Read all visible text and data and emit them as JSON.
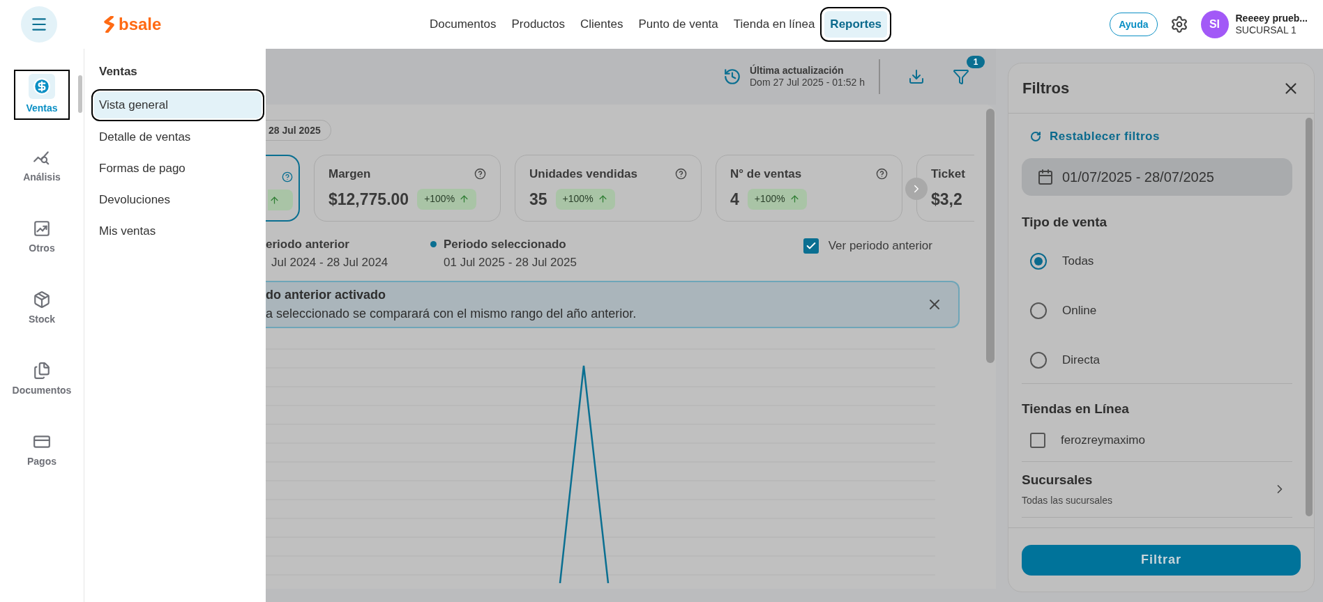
{
  "top_bar": {
    "brand": "bsale",
    "nav": [
      {
        "label": "Documentos",
        "selected": false
      },
      {
        "label": "Productos",
        "selected": false
      },
      {
        "label": "Clientes",
        "selected": false
      },
      {
        "label": "Punto de venta",
        "selected": false
      },
      {
        "label": "Tienda en línea",
        "selected": false
      },
      {
        "label": "Reportes",
        "selected": true
      }
    ],
    "help_button": "Ayuda",
    "user": {
      "initials": "SI",
      "name": "Reeeey prueb...",
      "branch": "SUCURSAL 1"
    }
  },
  "sidebar": {
    "items": [
      {
        "label": "Ventas",
        "selected": true
      },
      {
        "label": "Análisis",
        "selected": false
      },
      {
        "label": "Otros",
        "selected": false
      },
      {
        "label": "Stock",
        "selected": false
      },
      {
        "label": "Documentos",
        "selected": false
      },
      {
        "label": "Pagos",
        "selected": false
      }
    ]
  },
  "menu": {
    "title": "Ventas",
    "items": [
      {
        "label": "Vista general",
        "selected": true
      },
      {
        "label": "Detalle de ventas",
        "selected": false
      },
      {
        "label": "Formas de pago",
        "selected": false
      },
      {
        "label": "Devoluciones",
        "selected": false
      },
      {
        "label": "Mis ventas",
        "selected": false
      }
    ]
  },
  "report": {
    "last_update": {
      "label": "Última actualización",
      "value": "Dom 27 Jul 2025 - 01:52 h"
    },
    "filter_count": "1",
    "date_chip": "28 Jul 2025",
    "kpis": [
      {
        "kind": "partial",
        "selected": true
      },
      {
        "kind": "full",
        "title": "Margen",
        "value": "$12,775.00",
        "badge": "+100%",
        "selected": false
      },
      {
        "kind": "full",
        "title": "Unidades vendidas",
        "value": "35",
        "badge": "+100%",
        "selected": false
      },
      {
        "kind": "full",
        "title": "N° de ventas",
        "value": "4",
        "badge": "+100%",
        "selected": false
      },
      {
        "kind": "cut",
        "title": "Ticket",
        "value": "$3,2",
        "selected": false
      }
    ],
    "legend": [
      {
        "label": "eriodo anterior",
        "range": "Jul 2024 - 28 Jul 2024"
      },
      {
        "label": "Periodo seleccionado",
        "range": "01 Jul 2025 - 28 Jul 2025",
        "color": "#0a6f91"
      }
    ],
    "compare": {
      "label": "Ver periodo anterior",
      "checked": true
    },
    "alert": {
      "title": "do anterior activado",
      "message": "a seleccionado se comparará con el mismo rango del año anterior."
    }
  },
  "filters": {
    "title": "Filtros",
    "reset": "Restablecer filtros",
    "date_range": "01/07/2025 - 28/07/2025",
    "sale_type": {
      "title": "Tipo de venta",
      "options": [
        {
          "label": "Todas",
          "selected": true
        },
        {
          "label": "Online",
          "selected": false
        },
        {
          "label": "Directa",
          "selected": false
        }
      ]
    },
    "online_stores": {
      "title": "Tiendas en Línea",
      "stores": [
        {
          "label": "ferozreymaximo",
          "checked": false
        }
      ]
    },
    "branches": {
      "title": "Sucursales",
      "value": "Todas las sucursales"
    },
    "submit": "Filtrar"
  }
}
